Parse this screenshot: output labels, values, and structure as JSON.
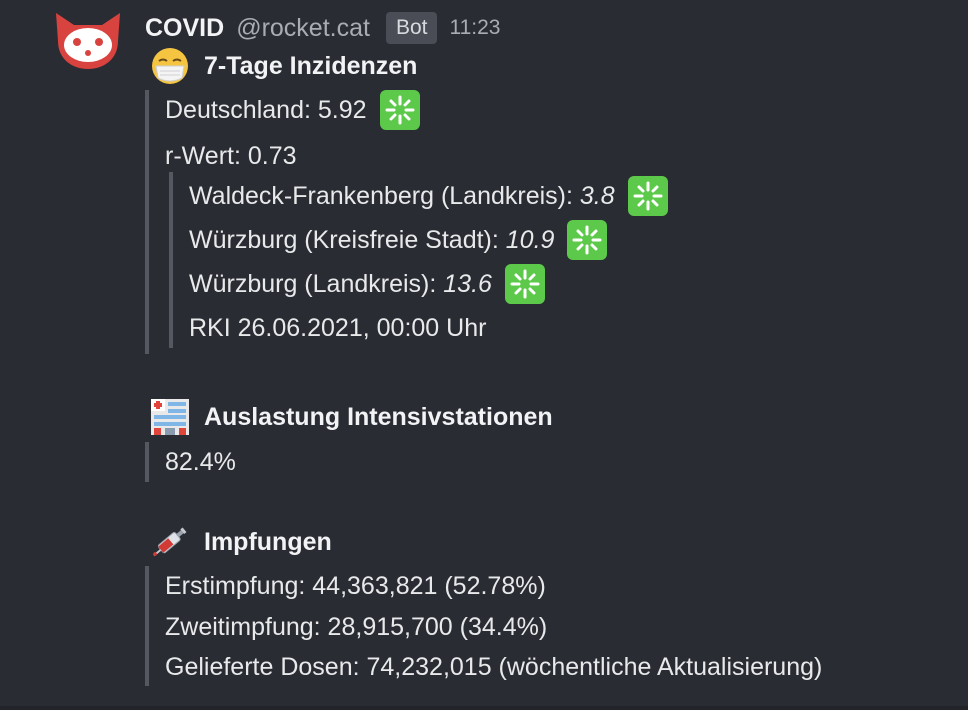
{
  "message": {
    "author_name": "COVID",
    "author_username": "@rocket.cat",
    "bot_badge": "Bot",
    "timestamp": "11:23",
    "avatar_icon": "rocket-cat-avatar-icon"
  },
  "incidence": {
    "icon": "face-with-medical-mask-icon",
    "title": "7-Tage Inzidenzen",
    "germany_label": "Deutschland: 5.92",
    "r_value_label": "r-Wert: 0.73",
    "status_icon": "sparkle-icon",
    "regions": [
      {
        "name": "Waldeck-Frankenberg (Landkreis):",
        "value": "3.8"
      },
      {
        "name": "Würzburg (Kreisfreie Stadt):",
        "value": "10.9"
      },
      {
        "name": "Würzburg (Landkreis):",
        "value": "13.6"
      }
    ],
    "source": "RKI 26.06.2021, 00:00 Uhr"
  },
  "icu": {
    "icon": "hospital-icon",
    "title": "Auslastung Intensivstationen",
    "value": "82.4%"
  },
  "vaccination": {
    "icon": "syringe-icon",
    "title": "Impfungen",
    "first_dose": "Erstimpfung: 44,363,821 (52.78%)",
    "second_dose": "Zweitimpfung: 28,915,700 (34.4%)",
    "delivered": "Gelieferte Dosen: 74,232,015 (wöchentliche Aktualisierung)"
  },
  "colors": {
    "background": "#2a2c33",
    "quote_border": "#555861",
    "sparkle_green": "#5cc94a",
    "avatar_red": "#d8433f"
  }
}
